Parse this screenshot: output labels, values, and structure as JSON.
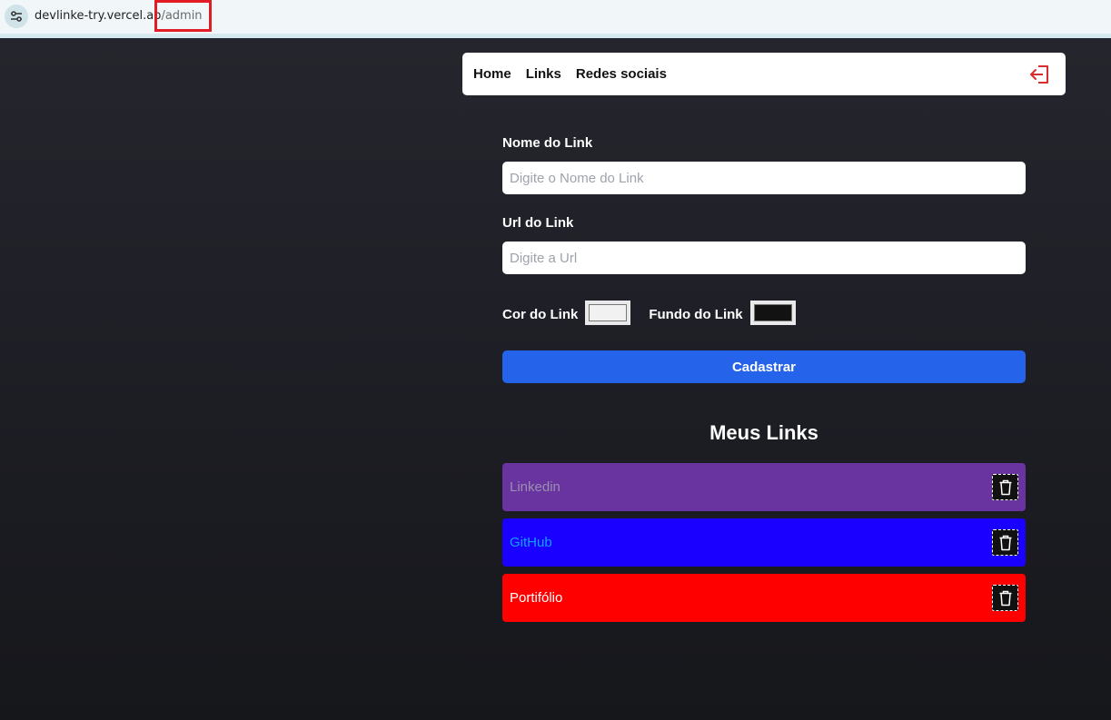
{
  "browser": {
    "url_domain": "devlinke-try.vercel.ap",
    "url_path": "/admin"
  },
  "nav": {
    "items": [
      {
        "label": "Home"
      },
      {
        "label": "Links"
      },
      {
        "label": "Redes sociais"
      }
    ],
    "logout_icon": "logout-icon"
  },
  "form": {
    "name_label": "Nome do Link",
    "name_placeholder": "Digite o Nome do Link",
    "url_label": "Url do Link",
    "url_placeholder": "Digite a Url",
    "color_label": "Cor do Link",
    "color_value": "#f1f1f1",
    "bg_label": "Fundo do Link",
    "bg_value": "#121212",
    "submit_label": "Cadastrar"
  },
  "links_section": {
    "title": "Meus Links",
    "items": [
      {
        "name": "Linkedin",
        "text_color": "#9a8fb0",
        "bg_color": "#6a34a0"
      },
      {
        "name": "GitHub",
        "text_color": "#14a0ff",
        "bg_color": "#1a00ff"
      },
      {
        "name": "Portifólio",
        "text_color": "#ffffff",
        "bg_color": "#ff0000"
      }
    ]
  },
  "colors": {
    "accent": "#2563eb",
    "background": "#1b1c21"
  }
}
